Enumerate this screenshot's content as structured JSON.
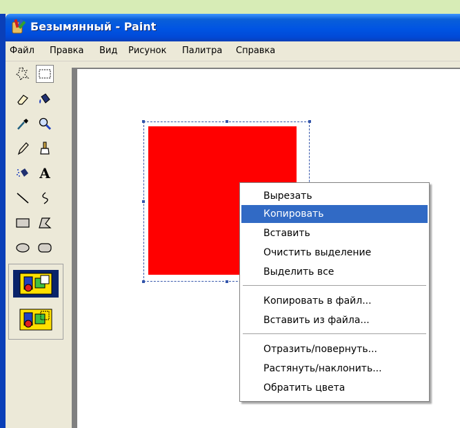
{
  "window": {
    "title": "Безымянный - Paint",
    "icon": "paint-app-icon"
  },
  "menubar": {
    "items": [
      "Файл",
      "Правка",
      "Вид",
      "Рисунок",
      "Палитра",
      "Справка"
    ]
  },
  "toolbox": {
    "tools": [
      {
        "name": "free-select-icon",
        "selected": false
      },
      {
        "name": "rect-select-icon",
        "selected": true
      },
      {
        "name": "eraser-icon",
        "selected": false
      },
      {
        "name": "fill-bucket-icon",
        "selected": false
      },
      {
        "name": "eyedropper-icon",
        "selected": false
      },
      {
        "name": "magnifier-icon",
        "selected": false
      },
      {
        "name": "pencil-icon",
        "selected": false
      },
      {
        "name": "brush-icon",
        "selected": false
      },
      {
        "name": "airbrush-icon",
        "selected": false
      },
      {
        "name": "text-icon",
        "selected": false,
        "glyph": "A"
      },
      {
        "name": "line-icon",
        "selected": false
      },
      {
        "name": "curve-icon",
        "selected": false
      },
      {
        "name": "rectangle-icon",
        "selected": false
      },
      {
        "name": "polygon-icon",
        "selected": false
      },
      {
        "name": "ellipse-icon",
        "selected": false
      },
      {
        "name": "rounded-rect-icon",
        "selected": false
      }
    ],
    "options": [
      {
        "name": "opaque-selection-icon",
        "selected": true
      },
      {
        "name": "transparent-selection-icon",
        "selected": false
      }
    ]
  },
  "canvas": {
    "shape_color": "#ff0000",
    "background": "#ffffff"
  },
  "context_menu": {
    "items": [
      "Вырезать",
      "Копировать",
      "Вставить",
      "Очистить выделение",
      "Выделить все",
      "Копировать в файл...",
      "Вставить из файла...",
      "Отразить/повернуть...",
      "Растянуть/наклонить...",
      "Обратить цвета"
    ],
    "highlighted": "Копировать",
    "highlight_color": "#316ac5"
  },
  "colors": {
    "titlebar": "#0054e3",
    "desktop": "#d7ecb6",
    "chrome": "#ece9d8"
  }
}
